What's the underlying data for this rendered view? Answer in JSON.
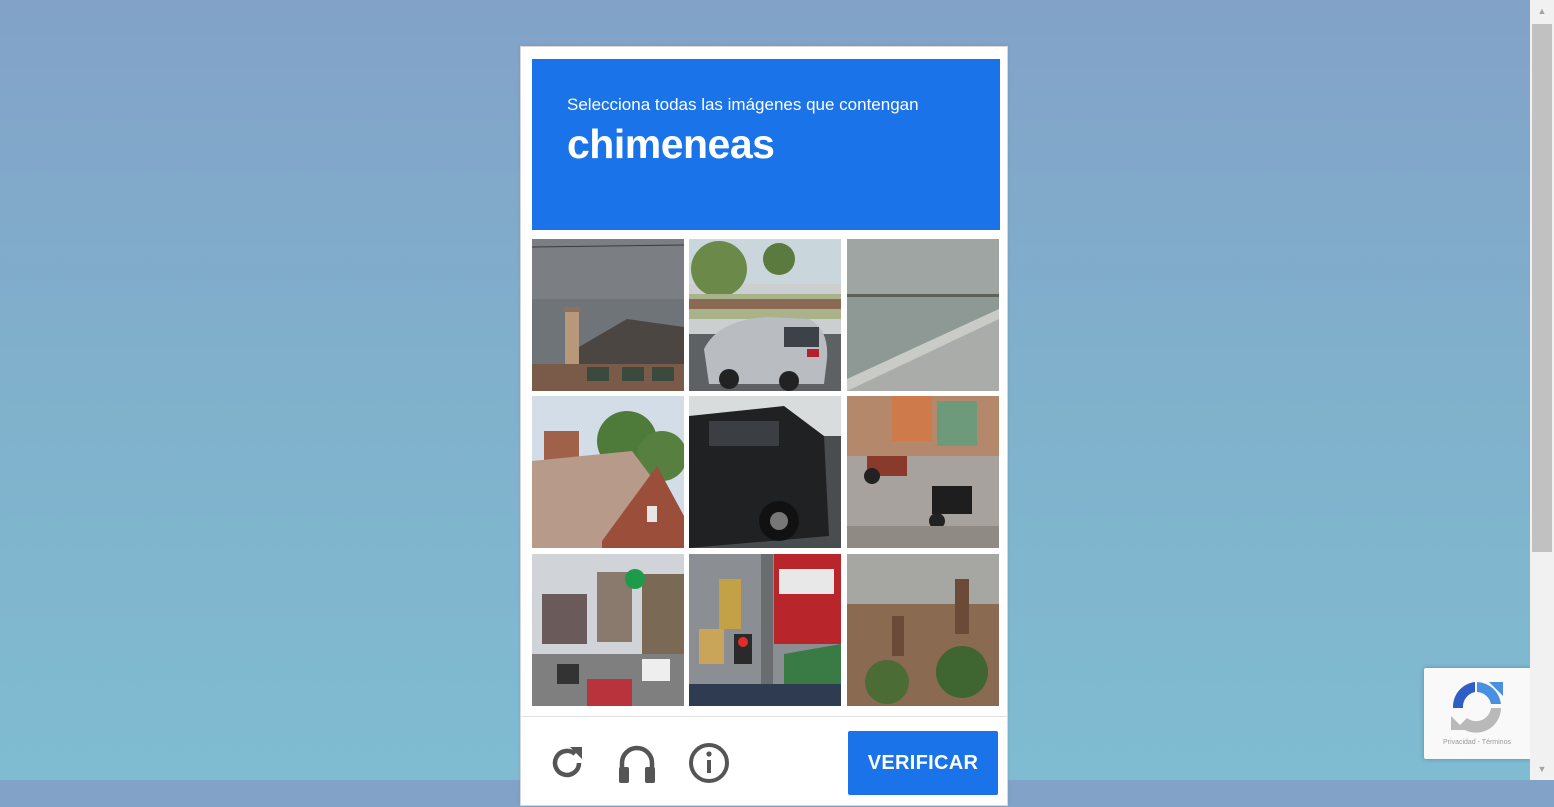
{
  "challenge": {
    "instruction": "Selecciona todas las imágenes que contengan",
    "target": "chimeneas",
    "tiles": [
      {
        "label": "tile-1"
      },
      {
        "label": "tile-2"
      },
      {
        "label": "tile-3"
      },
      {
        "label": "tile-4"
      },
      {
        "label": "tile-5"
      },
      {
        "label": "tile-6"
      },
      {
        "label": "tile-7"
      },
      {
        "label": "tile-8"
      },
      {
        "label": "tile-9"
      }
    ],
    "controls": [
      "reload-icon",
      "headphones-icon",
      "info-icon"
    ],
    "verify_label": "VERIFICAR",
    "accent": "#1a73e8"
  },
  "badge": {
    "legal": "Privacidad - Términos",
    "icon": "recaptcha-logo-icon"
  },
  "scrollbar": {
    "icons": [
      "chevron-up-icon",
      "chevron-down-icon"
    ]
  }
}
